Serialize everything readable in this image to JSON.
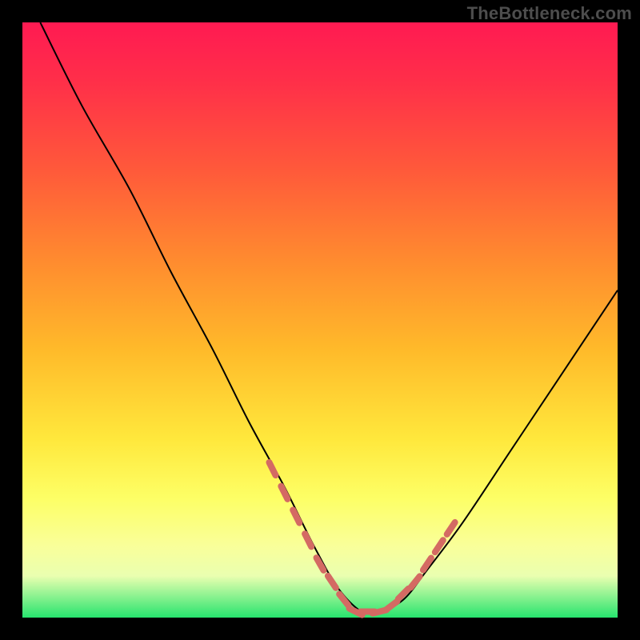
{
  "watermark": "TheBottleneck.com",
  "colors": {
    "frame": "#000000",
    "curve": "#000000",
    "marker": "#d46a63",
    "gradient_top": "#ff1a52",
    "gradient_bottom": "#27e46e"
  },
  "chart_data": {
    "type": "line",
    "title": "",
    "xlabel": "",
    "ylabel": "",
    "xlim": [
      0,
      100
    ],
    "ylim": [
      0,
      100
    ],
    "grid": false,
    "legend": false,
    "curve_comment": "V-shaped bottleneck curve; y ≈ percentage mismatch, minimum near x≈57",
    "x": [
      3,
      10,
      18,
      25,
      32,
      38,
      44,
      49,
      53,
      57,
      60,
      64,
      68,
      74,
      82,
      90,
      100
    ],
    "y": [
      100,
      86,
      72,
      58,
      45,
      33,
      22,
      12,
      5,
      1,
      1,
      3,
      8,
      16,
      28,
      40,
      55
    ],
    "markers_comment": "salmon dash/dot markers highlighting the low region of the curve",
    "markers_x": [
      42,
      44,
      46,
      48,
      50,
      52,
      54,
      56,
      58,
      60,
      62,
      64,
      66,
      68,
      70,
      72
    ],
    "markers_y": [
      25,
      21,
      17,
      13,
      9,
      6,
      3,
      1,
      1,
      1,
      2,
      4,
      6,
      9,
      12,
      15
    ]
  }
}
